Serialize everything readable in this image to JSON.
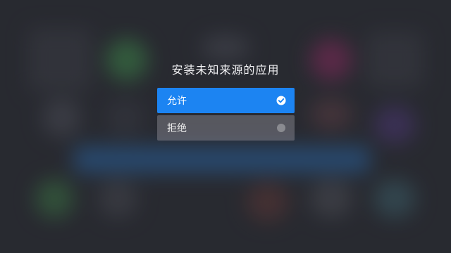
{
  "dialog": {
    "title": "安装未知来源的应用",
    "options": [
      {
        "label": "允许",
        "selected": true,
        "icon": "check-circle-icon"
      },
      {
        "label": "拒绝",
        "selected": false,
        "icon": "radio-unselected-icon"
      }
    ]
  },
  "colors": {
    "accent": "#1c84f2",
    "background": "#2f3037",
    "unselected_option": "#5b5c63"
  }
}
